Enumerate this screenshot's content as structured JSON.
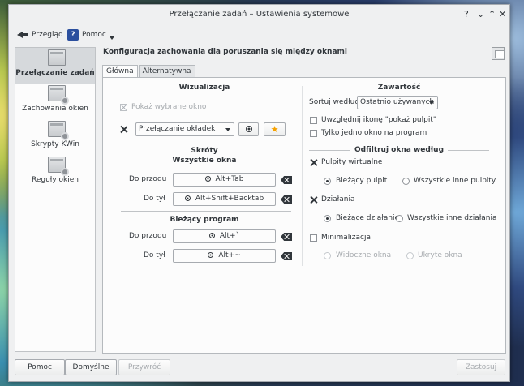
{
  "window": {
    "title": "Przełączanie zadań – Ustawienia systemowe",
    "buttons": {
      "help": "?",
      "minimize": "⌄",
      "maximize": "⌃",
      "close": "✕"
    }
  },
  "toolbar": {
    "overview_label": "Przegląd",
    "help_icon_text": "?",
    "help_label": "Pomoc"
  },
  "sidebar": {
    "items": [
      {
        "label": "Przełączanie zadań",
        "active": true
      },
      {
        "label": "Zachowania okien"
      },
      {
        "label": "Skrypty KWin"
      },
      {
        "label": "Reguły okien"
      }
    ]
  },
  "main": {
    "title": "Konfiguracja zachowania dla poruszania się między oknami",
    "tabs": [
      {
        "label": "Główna",
        "active": true
      },
      {
        "label": "Alternatywna"
      }
    ]
  },
  "visualization": {
    "title": "Wizualizacja",
    "show_selected_label": "Pokaż wybrane okno",
    "switcher_value": "Przełączanie okładek",
    "star_glyph": "★"
  },
  "shortcuts": {
    "title": "Skróty",
    "all_windows_title": "Wszystkie okna",
    "current_app_title": "Bieżący program",
    "forward_label": "Do przodu",
    "backward_label": "Do tył",
    "all_forward_value": "Alt+Tab",
    "all_backward_value": "Alt+Shift+Backtab",
    "app_forward_value": "Alt+`",
    "app_backward_value": "Alt+~"
  },
  "content": {
    "title": "Zawartość",
    "sort_label": "Sortuj według:",
    "sort_value": "Ostatnio używanych",
    "include_desktop_label": "Uwzględnij ikonę \"pokaż pulpit\"",
    "one_window_label": "Tylko jedno okno na program"
  },
  "filter": {
    "title": "Odfiltruj okna według",
    "virtual_desktops_label": "Pulpity wirtualne",
    "current_desktop_label": "Bieżący pulpit",
    "all_other_desktops_label": "Wszystkie inne pulpity",
    "activities_label": "Działania",
    "current_activity_label": "Bieżące działanie",
    "all_other_activities_label": "Wszystkie inne działania",
    "minimization_label": "Minimalizacja",
    "visible_windows_label": "Widoczne okna",
    "hidden_windows_label": "Ukryte okna"
  },
  "bottom": {
    "help": "Pomoc",
    "defaults": "Domyślne",
    "reset": "Przywróć",
    "apply": "Zastosuj"
  }
}
